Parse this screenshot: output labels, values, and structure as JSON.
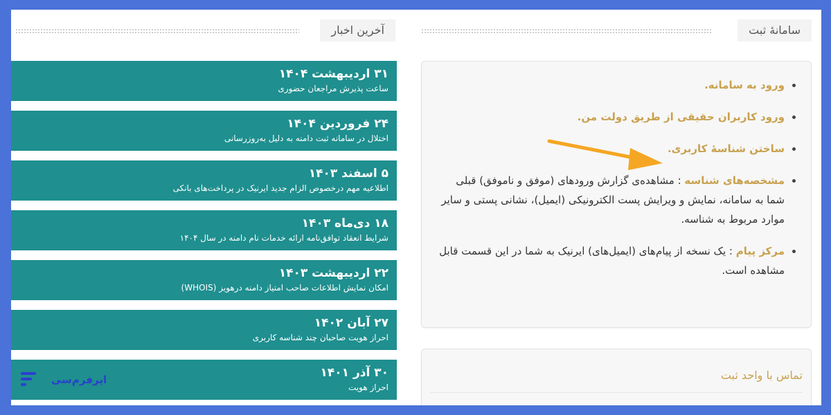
{
  "right_panel": {
    "title": "سامانهٔ ثبت",
    "items": [
      {
        "link": "ورود به سامانه."
      },
      {
        "link": "ورود کاربران حقیقی از طریق دولت من."
      },
      {
        "link": "ساختن شناسهٔ کاربری."
      },
      {
        "link": "مشخصه‌های شناسه",
        "text": " : مشاهده‌ی گزارش ورودهای (موفق و ناموفق) قبلی شما به سامانه، نمایش و ویرایش پست الکترونیکی (ایمیل)، نشانی پستی و سایر موارد مربوط به شناسه."
      },
      {
        "link": "مرکز پیام",
        "text": " : یک نسخه از پیام‌های (ایمیل‌های) ایرنیک به شما در این قسمت قابل مشاهده است."
      }
    ],
    "contact_title": "تماس با واحد ثبت"
  },
  "left_panel": {
    "title": "آخرین اخبار",
    "news": [
      {
        "date": "۳۱ اردیبهشت ۱۴۰۴",
        "desc": "ساعت پذیرش مراجعان حضوری"
      },
      {
        "date": "۲۴ فروردین ۱۴۰۴",
        "desc": "اختلال در سامانه ثبت دامنه به دلیل به‌روزرسانی"
      },
      {
        "date": "۵ اسفند ۱۴۰۳",
        "desc": "اطلاعیه مهم درخصوص الزام جدید ایرنیک در پرداخت‌های بانکی"
      },
      {
        "date": "۱۸ دی‌ماه ۱۴۰۳",
        "desc": "شرایط انعقاد توافق‌نامه ارائه خدمات نام دامنه در سال ۱۴۰۴"
      },
      {
        "date": "۲۲ اردیبهشت ۱۴۰۳",
        "desc": "امکان نمایش اطلاعات صاحب امتیاز دامنه درهویز (WHOIS)"
      },
      {
        "date": "۲۷ آبان ۱۴۰۲",
        "desc": "احراز هویت صاحبان چند شناسه کاربری"
      },
      {
        "date": "۳۰ آذر ۱۴۰۱",
        "desc": "احراز هویت"
      }
    ]
  },
  "brand": {
    "text": "ایرفرم‌سی"
  },
  "colors": {
    "accent": "#c9a14f",
    "news_bg": "#1f8f8f",
    "frame": "#4a72d8",
    "arrow": "#f5a623"
  }
}
